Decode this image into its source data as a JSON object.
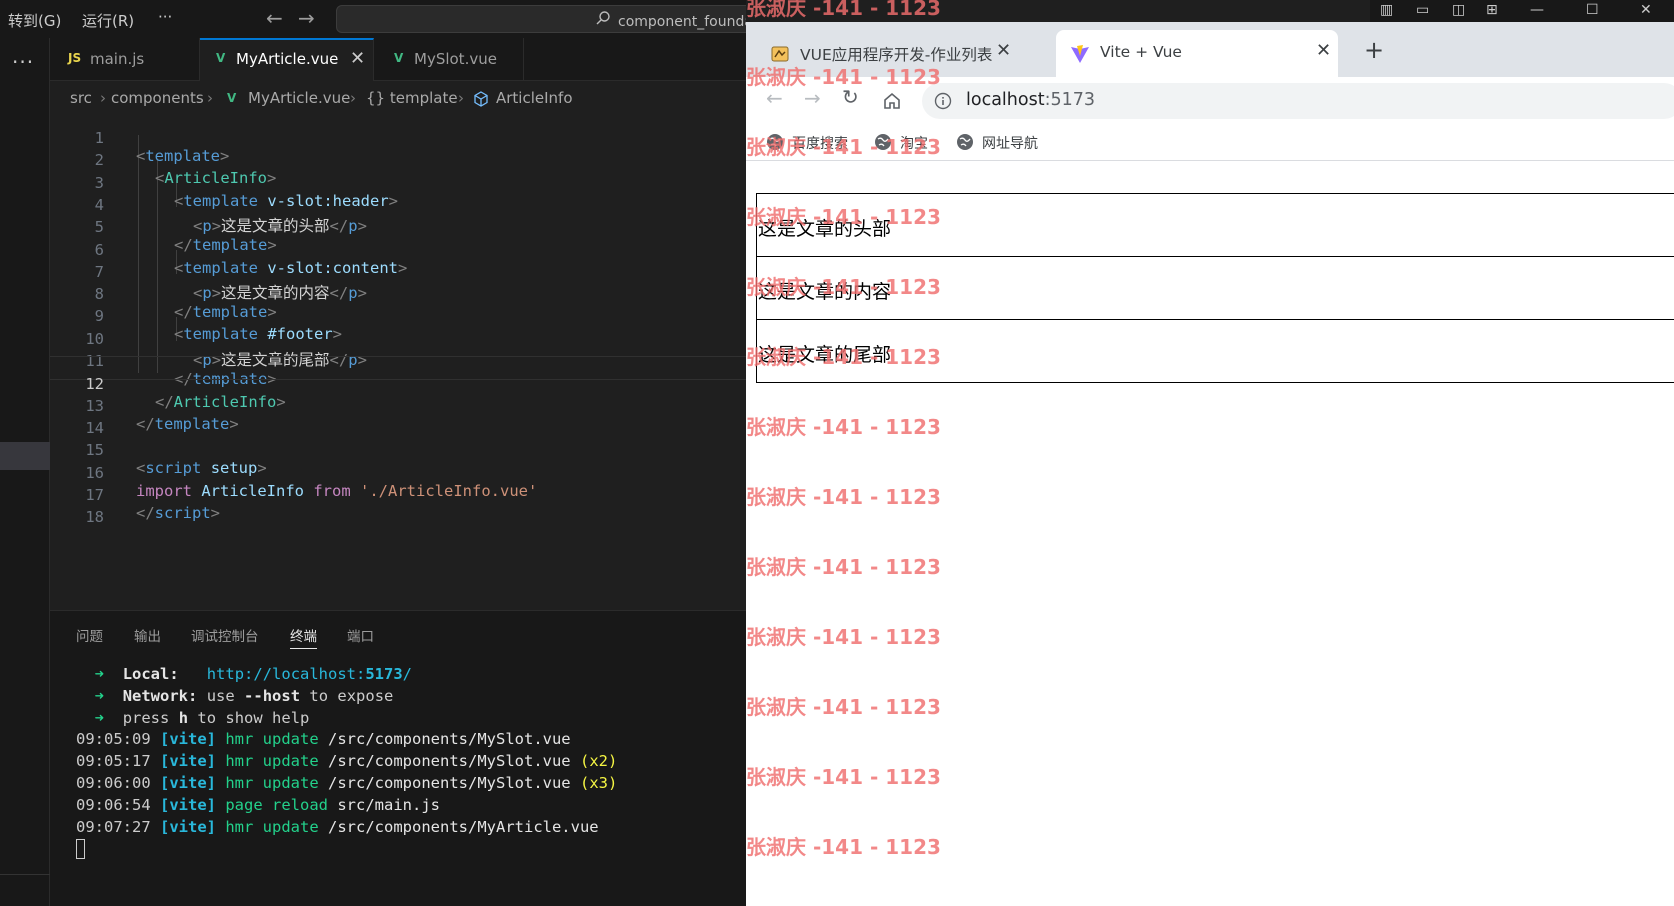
{
  "vscode": {
    "menu": {
      "goto": "转到(G)",
      "run": "运行(R)",
      "more": "···"
    },
    "command_center": "component_foundation [管理员]",
    "tabs": [
      {
        "icon": "JS",
        "label": "main.js"
      },
      {
        "icon": "V",
        "label": "MyArticle.vue",
        "close": "✕"
      },
      {
        "icon": "V",
        "label": "MySlot.vue"
      }
    ],
    "breadcrumb": [
      "src",
      "components",
      "MyArticle.vue",
      "{} template",
      "ArticleInfo"
    ],
    "code_lines": {
      "l1": {
        "n": "1"
      },
      "l2": {
        "n": "2"
      },
      "l3": {
        "n": "3",
        "attr": "v-slot:header"
      },
      "l4": {
        "n": "4",
        "text": "这是文章的头部"
      },
      "l5": {
        "n": "5"
      },
      "l6": {
        "n": "6",
        "attr": "v-slot:content"
      },
      "l7": {
        "n": "7",
        "text": "这是文章的内容"
      },
      "l8": {
        "n": "8"
      },
      "l9": {
        "n": "9",
        "attr": "#footer"
      },
      "l10": {
        "n": "10",
        "text": "这是文章的尾部"
      },
      "l11": {
        "n": "11"
      },
      "l12": {
        "n": "12"
      },
      "l13": {
        "n": "13"
      },
      "l14": {
        "n": "14"
      },
      "l15": {
        "n": "15",
        "tag": "script",
        "attr": "setup"
      },
      "l16": {
        "n": "16",
        "kw1": "import",
        "ident": "ArticleInfo",
        "kw2": "from",
        "str": "'./ArticleInfo.vue'"
      },
      "l17": {
        "n": "17",
        "tag": "script"
      },
      "l18": {
        "n": "18"
      }
    },
    "tokens": {
      "template": "template",
      "article_info": "ArticleInfo",
      "p": "p"
    },
    "panel_tabs": [
      "问题",
      "输出",
      "调试控制台",
      "终端",
      "端口"
    ],
    "terminal": {
      "arrow": "➜",
      "local_label": "Local",
      "local_url_prefix": "http://localhost:",
      "local_port": "5173",
      "network_label": "Network",
      "network_text_1": "use",
      "network_flag": "--host",
      "network_text_2": "to expose",
      "press_1": "press",
      "press_key": "h",
      "press_2": "to show help",
      "logs": [
        {
          "time": "09:05:09",
          "tag": "[vite]",
          "action": "hmr update",
          "path": "/src/components/MySlot.vue",
          "count": ""
        },
        {
          "time": "09:05:17",
          "tag": "[vite]",
          "action": "hmr update",
          "path": "/src/components/MySlot.vue",
          "count": "(x2)"
        },
        {
          "time": "09:06:00",
          "tag": "[vite]",
          "action": "hmr update",
          "path": "/src/components/MySlot.vue",
          "count": "(x3)"
        },
        {
          "time": "09:06:54",
          "tag": "[vite]",
          "action": "page reload",
          "path": "src/main.js",
          "count": ""
        },
        {
          "time": "09:07:27",
          "tag": "[vite]",
          "action": "hmr update",
          "path": "/src/components/MyArticle.vue",
          "count": ""
        }
      ]
    }
  },
  "browser": {
    "tabs": [
      {
        "label": "VUE应用程序开发-作业列表",
        "close": "✕"
      },
      {
        "label": "Vite + Vue",
        "close": "✕"
      }
    ],
    "new_tab": "+",
    "url_host": "localhost",
    "url_port": ":5173",
    "bookmarks": [
      "百度搜索",
      "淘宝",
      "网址导航"
    ],
    "page": {
      "header": "这是文章的头部",
      "content": "这是文章的内容",
      "footer": "这是文章的尾部"
    }
  },
  "watermark": "张淑庆 -141 - 1123",
  "colors": {
    "vue_green": "#41b883",
    "accent_blue": "#0078d4",
    "watermark_red": "#f06e6e"
  }
}
